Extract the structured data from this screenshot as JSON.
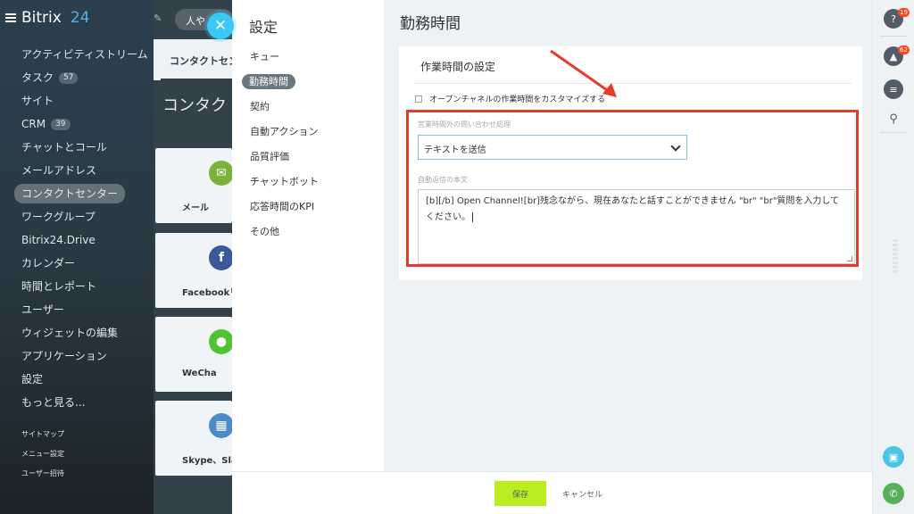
{
  "app": {
    "logo_text": "Bitrix",
    "logo_num": "24"
  },
  "left_nav": {
    "items": [
      {
        "label": "アクティビティストリーム"
      },
      {
        "label": "タスク",
        "count": "57"
      },
      {
        "label": "サイト"
      },
      {
        "label": "CRM",
        "count": "39"
      },
      {
        "label": "チャットとコール"
      },
      {
        "label": "メールアドレス"
      },
      {
        "label": "コンタクトセンター",
        "active": true
      },
      {
        "label": "ワークグループ"
      },
      {
        "label": "Bitrix24.Drive"
      },
      {
        "label": "カレンダー"
      },
      {
        "label": "時間とレポート"
      },
      {
        "label": "ユーザー"
      },
      {
        "label": "ウィジェットの編集"
      },
      {
        "label": "アプリケーション"
      },
      {
        "label": "設定"
      },
      {
        "label": "もっと見る..."
      }
    ],
    "small": [
      "サイトマップ",
      "メニュー設定",
      "ユーザー招待"
    ]
  },
  "bg_main": {
    "tab": "コンタクトセン",
    "heading": "コンタク",
    "search_placeholder": "人や",
    "tiles": [
      {
        "label": "メール",
        "color": "#7bb33a"
      },
      {
        "label": "Facebookリ",
        "color": "#3b5998"
      },
      {
        "label": "WeCha",
        "color": "#51c332"
      },
      {
        "label": "Skype、Slack",
        "color": "#4d8bc7"
      }
    ]
  },
  "settings": {
    "title": "設定",
    "menu": [
      {
        "label": "キュー"
      },
      {
        "label": "勤務時間",
        "active": true
      },
      {
        "label": "契約"
      },
      {
        "label": "自動アクション"
      },
      {
        "label": "品質評価"
      },
      {
        "label": "チャットボット"
      },
      {
        "label": "応答時間のKPI"
      },
      {
        "label": "その他"
      }
    ]
  },
  "content": {
    "page_title": "勤務時間",
    "card_title": "作業時間の設定",
    "checkbox_label": "オープンチャネルの作業時間をカスタマイズする",
    "out_of_hours_label": "営業時間外の問い合わせ処理",
    "out_of_hours_value": "テキストを送信",
    "auto_reply_label": "自動返信の本文",
    "auto_reply_text": "[b][/b] Open Channel![br]残念ながら、現在あなたと話すことができません \"br\" \"br\"質問を入力してください。"
  },
  "footer": {
    "save": "保存",
    "cancel": "キャンセル"
  },
  "rail": {
    "help_badge": "19",
    "bell_badge": "62"
  },
  "colors": {
    "highlight": "#e83a2c",
    "save": "#bbed21",
    "accent": "#3bc8f5"
  }
}
